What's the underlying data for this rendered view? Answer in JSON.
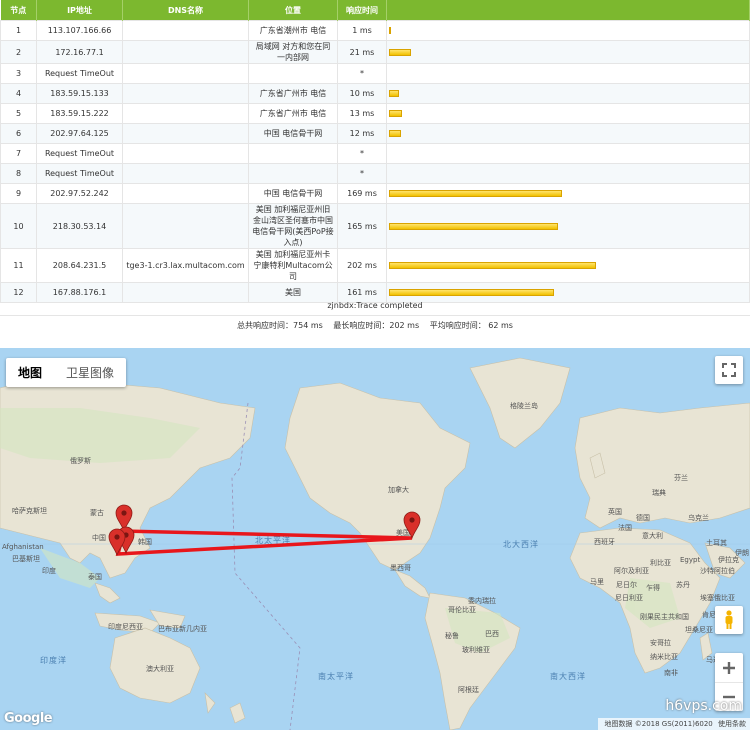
{
  "table": {
    "headers": [
      "节点",
      "IP地址",
      "DNS名称",
      "位置",
      "响应时间",
      ""
    ],
    "rows": [
      {
        "hop": "1",
        "ip": "113.107.166.66",
        "dns": "",
        "location": "广东省潮州市 电信",
        "time": "1 ms",
        "ms": 1
      },
      {
        "hop": "2",
        "ip": "172.16.77.1",
        "dns": "",
        "location": "局域网 对方和您在同一内部网",
        "time": "21 ms",
        "ms": 21
      },
      {
        "hop": "3",
        "ip": "Request TimeOut",
        "dns": "",
        "location": "",
        "time": "*",
        "ms": 0
      },
      {
        "hop": "4",
        "ip": "183.59.15.133",
        "dns": "",
        "location": "广东省广州市 电信",
        "time": "10 ms",
        "ms": 10
      },
      {
        "hop": "5",
        "ip": "183.59.15.222",
        "dns": "",
        "location": "广东省广州市 电信",
        "time": "13 ms",
        "ms": 13
      },
      {
        "hop": "6",
        "ip": "202.97.64.125",
        "dns": "",
        "location": "中国 电信骨干网",
        "time": "12 ms",
        "ms": 12
      },
      {
        "hop": "7",
        "ip": "Request TimeOut",
        "dns": "",
        "location": "",
        "time": "*",
        "ms": 0
      },
      {
        "hop": "8",
        "ip": "Request TimeOut",
        "dns": "",
        "location": "",
        "time": "*",
        "ms": 0
      },
      {
        "hop": "9",
        "ip": "202.97.52.242",
        "dns": "",
        "location": "中国 电信骨干网",
        "time": "169 ms",
        "ms": 169
      },
      {
        "hop": "10",
        "ip": "218.30.53.14",
        "dns": "",
        "location": "美国 加利福尼亚州旧金山湾区圣何塞市中国电信骨干网(美西PoP接入点)",
        "time": "165 ms",
        "ms": 165
      },
      {
        "hop": "11",
        "ip": "208.64.231.5",
        "dns": "tge3-1.cr3.lax.multacom.com",
        "location": "美国 加利福尼亚州卡宁康特利Multacom公司",
        "time": "202 ms",
        "ms": 202
      },
      {
        "hop": "12",
        "ip": "167.88.176.1",
        "dns": "",
        "location": "美国",
        "time": "161 ms",
        "ms": 161
      }
    ],
    "status": "zjnbdx:Trace completed",
    "summary": {
      "total": "总共响应时间：754 ms",
      "max": "最长响应时间：202 ms",
      "avg": "平均响应时间： 62 ms"
    }
  },
  "map": {
    "type_map": "地图",
    "type_satellite": "卫星图像",
    "labels": [
      "格陵兰岛",
      "俄罗斯",
      "哈萨克斯坦",
      "蒙古",
      "中国",
      "韩国",
      "泰国",
      "Afghanistan",
      "巴基斯坦",
      "印度",
      "加拿大",
      "美国",
      "墨西哥",
      "委内瑞拉",
      "哥伦比亚",
      "秘鲁",
      "巴西",
      "玻利维亚",
      "阿根廷",
      "英国",
      "法国",
      "瑞典",
      "芬兰",
      "德国",
      "乌克兰",
      "西班牙",
      "意大利",
      "土耳其",
      "伊拉克",
      "伊朗",
      "阿尔及利亚",
      "利比亚",
      "Egypt",
      "马里",
      "尼日尔",
      "尼日利亚",
      "乍得",
      "苏丹",
      "沙特阿拉伯",
      "埃塞俄比亚",
      "肯尼亚",
      "刚果民主共和国",
      "坦桑尼亚",
      "安哥拉",
      "纳米比亚",
      "南非",
      "马达加斯加",
      "印度尼西亚",
      "巴布亚新几内亚",
      "澳大利亚"
    ],
    "oceans": [
      "北太平洋",
      "北大西洋",
      "印度洋",
      "南太平洋",
      "南大西洋"
    ],
    "google": "Google",
    "credits": [
      "地图数据 ©2018 GS(2011)6020",
      "使用条款"
    ],
    "watermark": "h6vps.com",
    "route_color": "#e8161b",
    "pin_color": "#d9302a"
  }
}
